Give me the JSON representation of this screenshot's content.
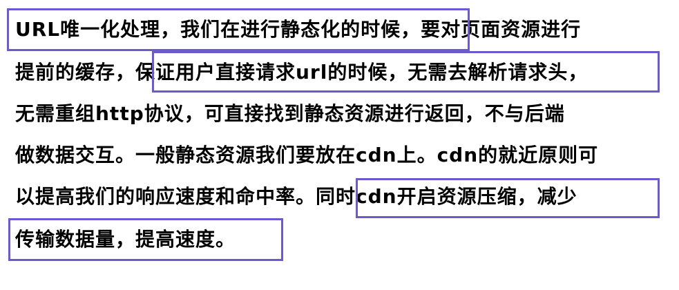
{
  "document": {
    "lines": [
      "URL唯一化处理，我们在进行静态化的时候，要对页面资源进行",
      "提前的缓存，保证用户直接请求url的时候，无需去解析请求头，",
      "无需重组http协议，可直接找到静态资源进行返回，不与后端",
      "做数据交互。一般静态资源我们要放在cdn上。cdn的就近原则可",
      "以提高我们的响应速度和命中率。同时cdn开启资源压缩，减少",
      "传输数据量，提高速度。"
    ],
    "highlight_color": "#6a5acd"
  }
}
